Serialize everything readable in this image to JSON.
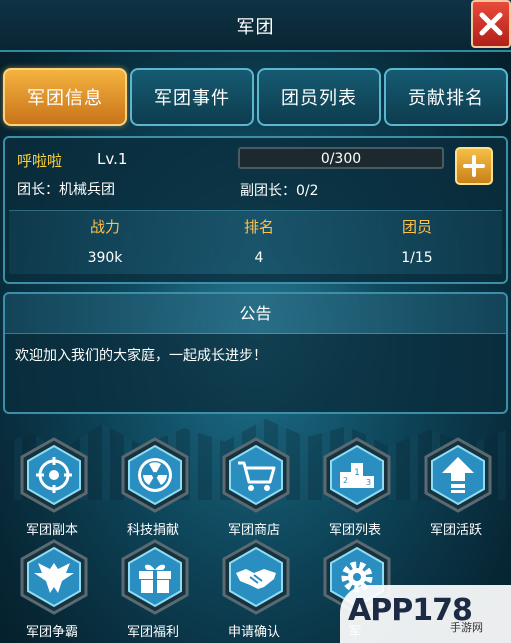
{
  "window": {
    "title": "军团"
  },
  "tabs": [
    {
      "label": "军团信息",
      "active": true
    },
    {
      "label": "军团事件",
      "active": false
    },
    {
      "label": "团员列表",
      "active": false
    },
    {
      "label": "贡献排名",
      "active": false
    }
  ],
  "info": {
    "name": "呼啦啦",
    "level": "Lv.1",
    "leader": "团长：机械兵团",
    "vice_leader": "副团长：0/2",
    "exp_text": "0/300",
    "exp_progress": 0,
    "stats": [
      {
        "label": "战力",
        "value": "390k"
      },
      {
        "label": "排名",
        "value": "4"
      },
      {
        "label": "团员",
        "value": "1/15"
      }
    ]
  },
  "notice": {
    "title": "公告",
    "text": "欢迎加入我们的大家庭，一起成长进步！"
  },
  "functions": [
    {
      "label": "军团副本",
      "icon": "crosshair-icon"
    },
    {
      "label": "科技捐献",
      "icon": "radiation-icon"
    },
    {
      "label": "军团商店",
      "icon": "shopping-cart-icon"
    },
    {
      "label": "军团列表",
      "icon": "podium-icon"
    },
    {
      "label": "军团活跃",
      "icon": "arrow-up-icon"
    },
    {
      "label": "军团争霸",
      "icon": "eagle-icon"
    },
    {
      "label": "军团福利",
      "icon": "gift-icon"
    },
    {
      "label": "申请确认",
      "icon": "handshake-icon"
    },
    {
      "label": "军",
      "icon": "gear-icon"
    }
  ],
  "watermark": {
    "text": "APP178",
    "sub": "手游网"
  },
  "colors": {
    "gold": "#ffc24a",
    "tab_active": "#f4b33f",
    "panel_border": "#3d8fa8",
    "close_red": "#d6302a"
  }
}
